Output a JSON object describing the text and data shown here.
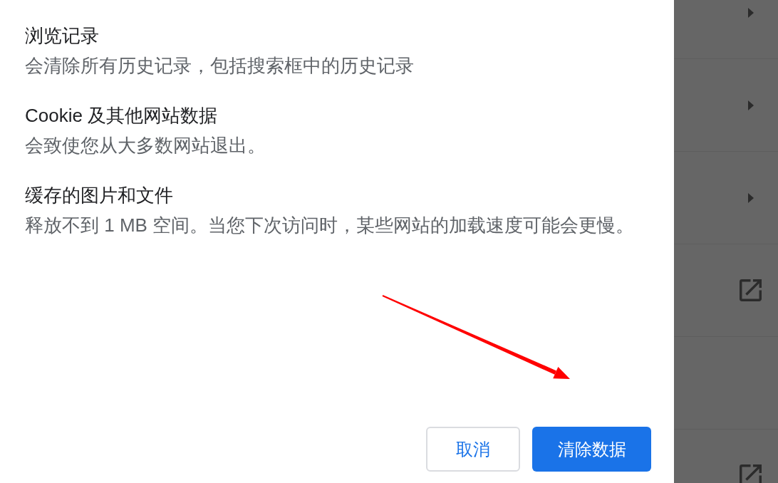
{
  "dialog": {
    "options": [
      {
        "title": "浏览记录",
        "description": "会清除所有历史记录，包括搜索框中的历史记录"
      },
      {
        "title": "Cookie 及其他网站数据",
        "description": "会致使您从大多数网站退出。"
      },
      {
        "title": "缓存的图片和文件",
        "description": "释放不到 1 MB 空间。当您下次访问时，某些网站的加载速度可能会更慢。"
      }
    ],
    "buttons": [
      {
        "label": "取消",
        "kind": "secondary"
      },
      {
        "label": "清除数据",
        "kind": "primary"
      }
    ]
  },
  "background_rows": [
    {
      "kind": "submenu"
    },
    {
      "kind": "submenu"
    },
    {
      "kind": "submenu"
    },
    {
      "kind": "external"
    },
    {
      "kind": "blank"
    },
    {
      "kind": "external"
    }
  ]
}
